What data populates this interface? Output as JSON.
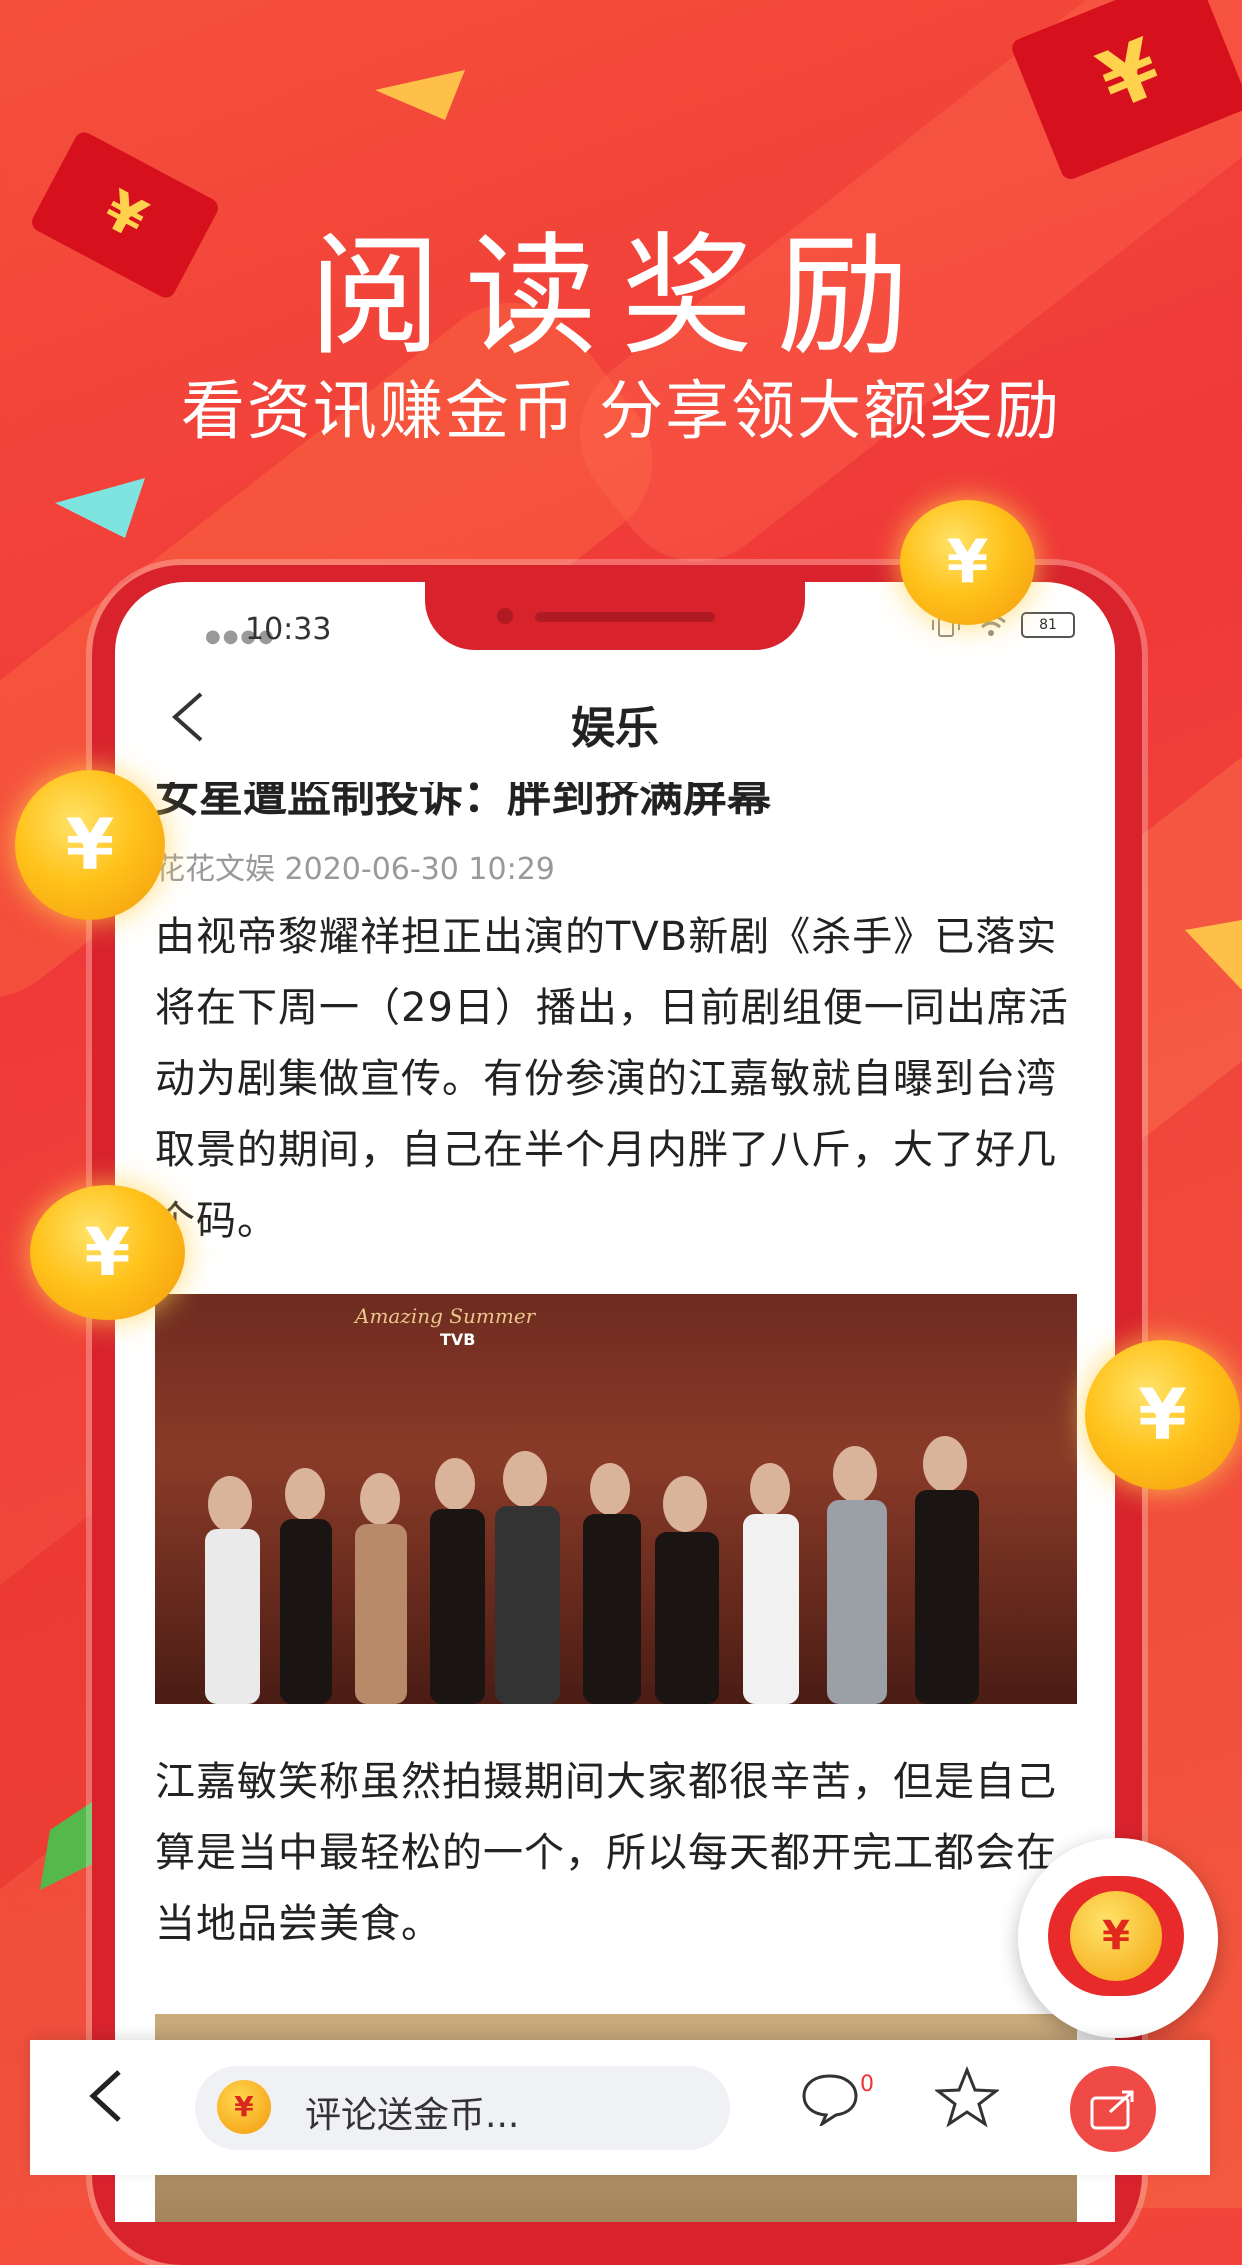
{
  "promo": {
    "headline": "阅读奖励",
    "subline": "看资讯赚金币 分享领大额奖励",
    "coin_symbol": "¥"
  },
  "status_bar": {
    "time": "10:33",
    "battery": "81"
  },
  "nav": {
    "back_icon": "chevron-left-icon",
    "title": "娱乐"
  },
  "article": {
    "title": "女星遭监制投诉：胖到挤满屏幕",
    "source": "花花文娱",
    "datetime": "2020-06-30 10:29",
    "paragraph1": "由视帝黎耀祥担正出演的TVB新剧《杀手》已落实将在下周一（29日）播出，日前剧组便一同出席活动为剧集做宣传。有份参演的江嘉敏就自曝到台湾取景的期间，自己在半个月内胖了八斤，大了好几个码。",
    "paragraph2": "江嘉敏笑称虽然拍摄期间大家都很辛苦，但是自己算是当中最轻松的一个，所以每天都开完工都会在当地品尝美食。",
    "photo_caption_logo": "Amazing Summer",
    "photo_tvb": "TVB"
  },
  "bottom_bar": {
    "back_icon": "chevron-left-icon",
    "comment_placeholder": "评论送金币...",
    "comment_count": "0",
    "comment_icon": "speech-bubble-icon",
    "favorite_icon": "star-icon",
    "share_icon": "share-icon"
  },
  "colors": {
    "background": "#ef3838",
    "accent": "#d8232d",
    "coin": "#ffc21a"
  }
}
